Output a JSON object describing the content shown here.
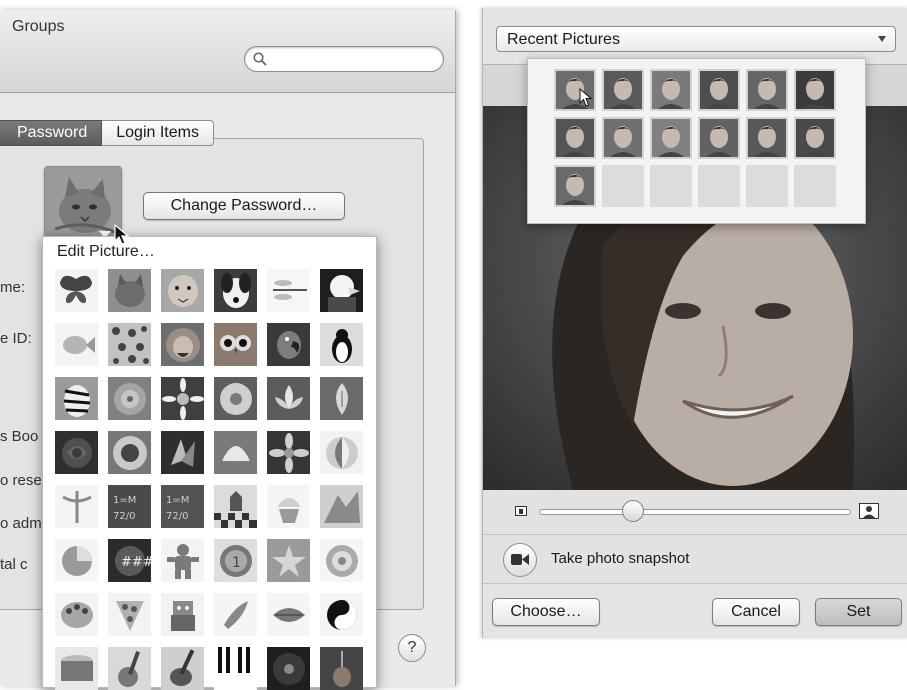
{
  "left_window": {
    "groups_label": "Groups",
    "search": {
      "value": "",
      "placeholder": ""
    },
    "tabs": [
      {
        "label": "Password"
      },
      {
        "label": "Login Items"
      }
    ],
    "change_password_label": "Change Password…",
    "side_labels": [
      "me:",
      "e ID:",
      "s Boo",
      "o rese",
      "o adm",
      "tal c"
    ],
    "help_label": "?",
    "picker": {
      "title": "Edit Picture…",
      "pictures": [
        "butterfly",
        "cat",
        "cheetah",
        "dog",
        "dragonfly",
        "eagle",
        "fish",
        "leopard",
        "lion",
        "owl",
        "parrot",
        "penguin",
        "zebra",
        "dahlia",
        "daisy",
        "flower",
        "lotus",
        "lilly",
        "red-rose",
        "sunflower",
        "zen",
        "snowy-flower",
        "whirl",
        "beach-ball",
        "medical",
        "chalk",
        "chalk-2",
        "chess",
        "cupcake",
        "earth",
        "pie",
        "gear-shift",
        "gingerbread-man",
        "medal",
        "star",
        "target",
        "palette",
        "pizza",
        "robot",
        "rocket",
        "lips",
        "yin-yang",
        "drum",
        "guitar",
        "electric-guitar",
        "piano",
        "vinyl",
        "violin"
      ]
    }
  },
  "right_window": {
    "source_select": "Recent Pictures",
    "recent_cells": 18,
    "recent_filled": 13,
    "zoom_level": 0.3,
    "snapshot_label": "Take photo snapshot",
    "choose_label": "Choose…",
    "cancel_label": "Cancel",
    "set_label": "Set"
  }
}
